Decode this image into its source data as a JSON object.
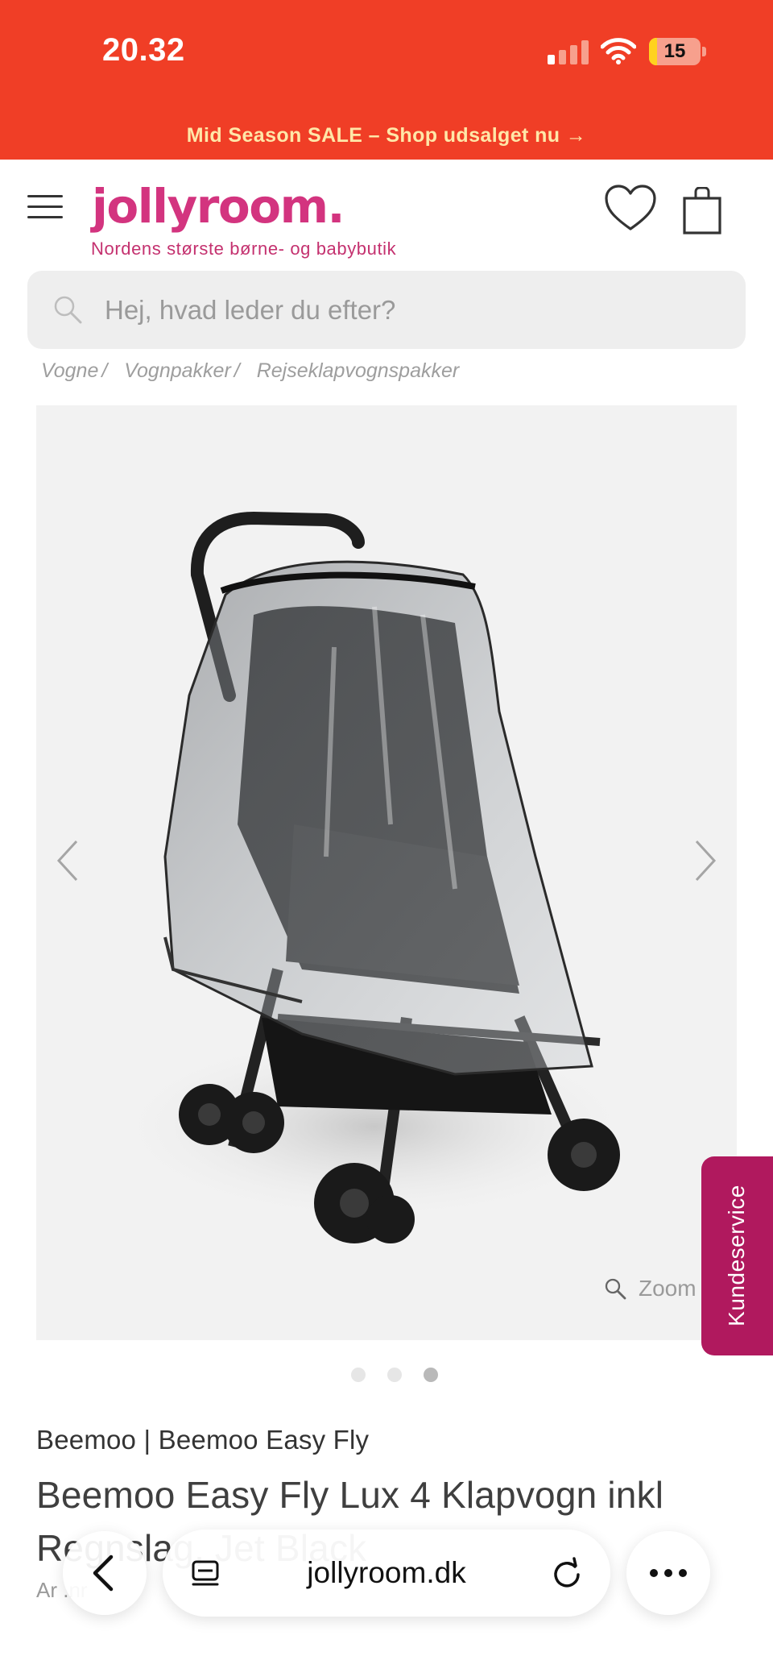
{
  "status_bar": {
    "time": "20.32",
    "battery": "15",
    "battery_level": 0.15
  },
  "promo": {
    "text": "Mid Season SALE – Shop udsalget nu →"
  },
  "header": {
    "logo": "jollyroom.",
    "tagline": "Nordens største børne- og babybutik",
    "icons": {
      "menu": "hamburger-menu-icon",
      "wishlist": "heart-icon",
      "cart": "shopping-bag-icon"
    }
  },
  "search": {
    "placeholder": "Hej, hvad leder du efter?"
  },
  "breadcrumb": [
    "Vogne",
    "Vognpakker",
    "Rejseklapvognspakker"
  ],
  "gallery": {
    "zoom_label": "Zoom",
    "image_count": 3,
    "active_index": 2
  },
  "service_tab": {
    "label": "Kundeservice"
  },
  "product": {
    "brand_line": "Beemoo | Beemoo Easy Fly",
    "title": "Beemoo Easy Fly Lux 4 Klapvogn inkl Regnslag, Jet Black",
    "article_prefix": "Ar    .nr"
  },
  "browser": {
    "url": "jollyroom.dk"
  },
  "colors": {
    "brand_red": "#f03e26",
    "brand_pink": "#d3347f",
    "service_magenta": "#b0195e",
    "promo_text": "#ffe7a8"
  }
}
